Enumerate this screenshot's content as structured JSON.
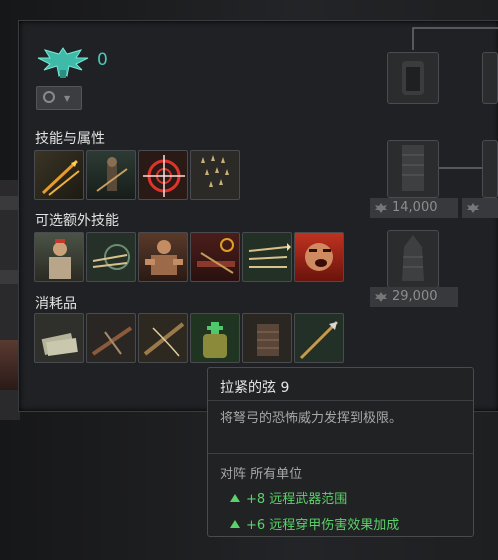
{
  "header": {
    "count": "0"
  },
  "sections": {
    "skills_title": "技能与属性",
    "optional_title": "可选额外技能",
    "consumables_title": "消耗品"
  },
  "skills": [
    {
      "icon": "flaming-arrows-icon"
    },
    {
      "icon": "archer-forest-icon"
    },
    {
      "icon": "target-reticle-icon"
    },
    {
      "icon": "arrow-volley-icon"
    }
  ],
  "optional_skills": [
    {
      "icon": "general-portrait-icon"
    },
    {
      "icon": "crossbow-bolts-target-icon"
    },
    {
      "icon": "warrior-strength-icon"
    },
    {
      "icon": "crossbow-reload-icon"
    },
    {
      "icon": "triple-bolts-icon"
    },
    {
      "icon": "war-cry-icon"
    }
  ],
  "consumables": [
    {
      "icon": "money-bundle-icon"
    },
    {
      "icon": "crossbow-icon"
    },
    {
      "icon": "crossbow-string-icon"
    },
    {
      "icon": "green-medicine-pouch-icon"
    },
    {
      "icon": "lamellar-armor-icon"
    },
    {
      "icon": "spear-bolt-icon"
    }
  ],
  "tree": {
    "cost_1": "14,000",
    "cost_2": "29,000"
  },
  "tooltip": {
    "title": "拉紧的弦 9",
    "description": "将弩弓的恐怖威力发挥到极限。",
    "versus": "对阵 所有单位",
    "bonus_1": "+8 远程武器范围",
    "bonus_2": "+6 远程穿甲伤害效果加成"
  },
  "colors": {
    "accent": "#49c9b8",
    "bonus": "#5bd269"
  }
}
